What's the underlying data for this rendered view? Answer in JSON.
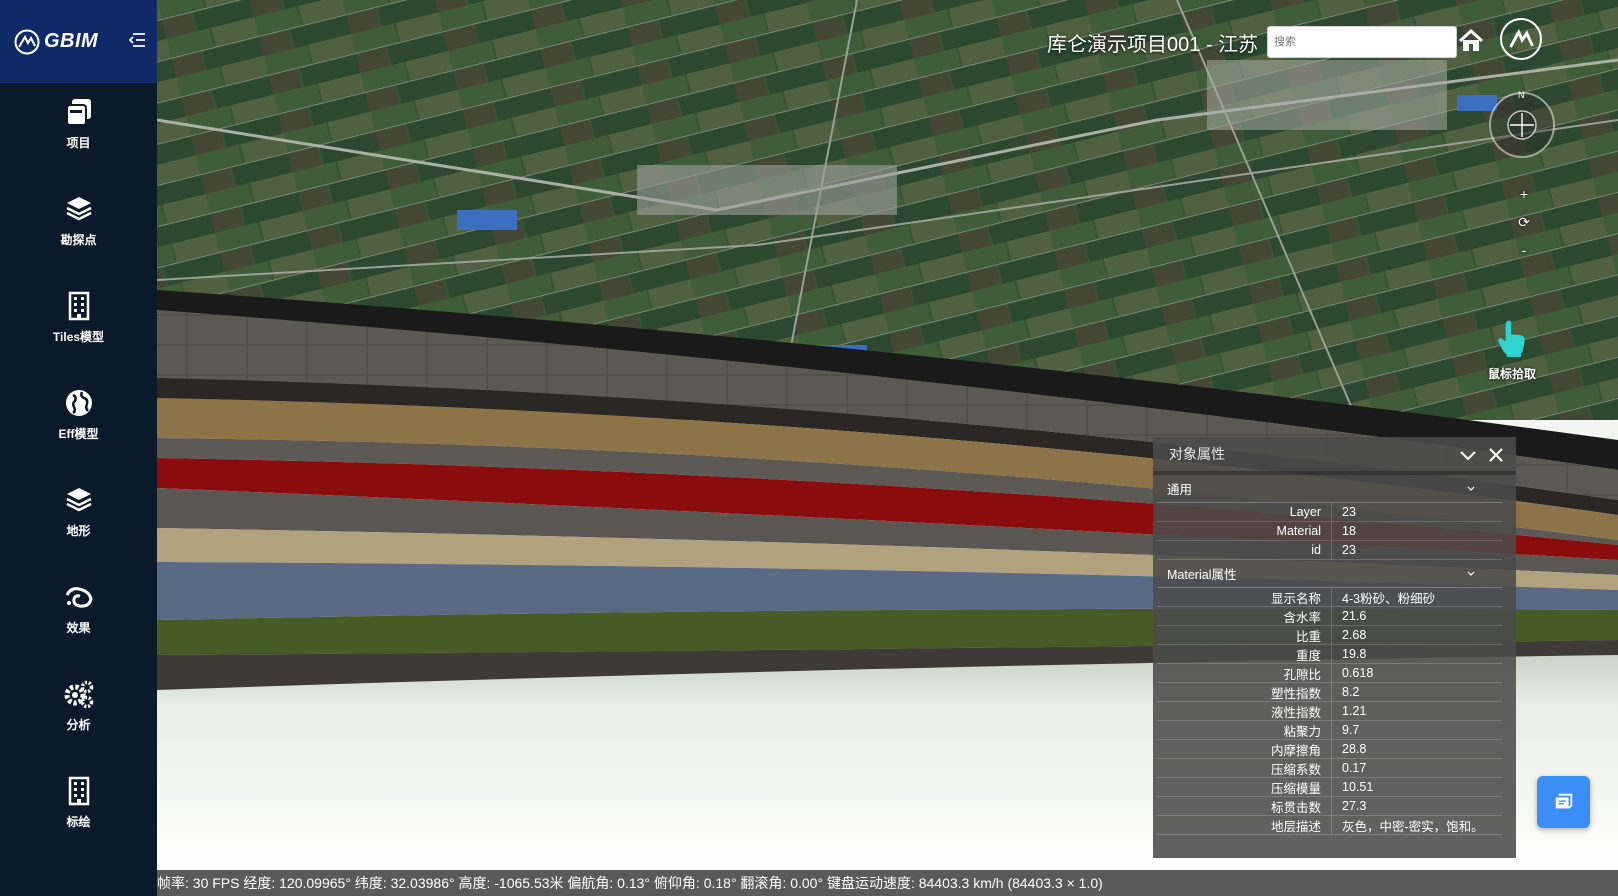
{
  "brand": {
    "name": "GBIM"
  },
  "sidebar": {
    "items": [
      {
        "label": "项目",
        "icon": "project-icon"
      },
      {
        "label": "勘探点",
        "icon": "layers-icon"
      },
      {
        "label": "Tiles模型",
        "icon": "building-icon"
      },
      {
        "label": "Eff模型",
        "icon": "globe-icon"
      },
      {
        "label": "地形",
        "icon": "layers-icon"
      },
      {
        "label": "效果",
        "icon": "effect-icon"
      },
      {
        "label": "分析",
        "icon": "gears-icon"
      },
      {
        "label": "标绘",
        "icon": "building-icon"
      }
    ]
  },
  "header": {
    "project_title": "库仑演示项目001 - 江苏",
    "search_placeholder": "搜索"
  },
  "map_controls": {
    "compass_letter": "N",
    "zoom_in": "+",
    "reset": "⟳",
    "zoom_out": "-",
    "pick_tool_label": "鼠标拾取"
  },
  "properties_panel": {
    "title": "对象属性",
    "sections": [
      {
        "title": "通用",
        "rows": [
          {
            "key": "Layer",
            "value": "23"
          },
          {
            "key": "Material",
            "value": "18"
          },
          {
            "key": "id",
            "value": "23"
          }
        ]
      },
      {
        "title": "Material属性",
        "rows": [
          {
            "key": "显示名称",
            "value": "4-3粉砂、粉细砂"
          },
          {
            "key": "含水率",
            "value": "21.6"
          },
          {
            "key": "比重",
            "value": "2.68"
          },
          {
            "key": "重度",
            "value": "19.8"
          },
          {
            "key": "孔隙比",
            "value": "0.618"
          },
          {
            "key": "塑性指数",
            "value": "8.2"
          },
          {
            "key": "液性指数",
            "value": "1.21"
          },
          {
            "key": "粘聚力",
            "value": "9.7"
          },
          {
            "key": "内摩擦角",
            "value": "28.8"
          },
          {
            "key": "压缩系数",
            "value": "0.17"
          },
          {
            "key": "压缩模量",
            "value": "10.51"
          },
          {
            "key": "标贯击数",
            "value": "27.3"
          },
          {
            "key": "地层描述",
            "value": "灰色，中密-密实，饱和。"
          }
        ]
      }
    ]
  },
  "status_bar": {
    "text": "帧率: 30 FPS 经度: 120.09965° 纬度: 32.03986° 高度: -1065.53米 偏航角: 0.13° 俯仰角: 0.18° 翻滚角: 0.00° 键盘运动速度: 84403.3 km/h (84403.3 × 1.0)"
  },
  "colors": {
    "brand_bg": "#0f2a66",
    "sidebar_bg": "#0b1a2b",
    "accent": "#3a8ef6",
    "pick_tool": "#2fd4d0"
  }
}
